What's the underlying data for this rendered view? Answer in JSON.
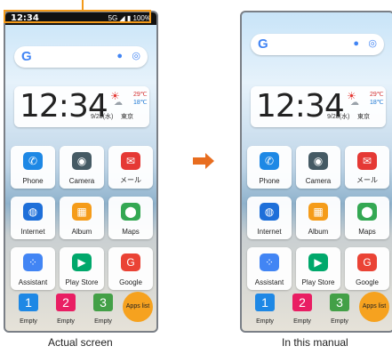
{
  "status": {
    "time": "12:34",
    "signal": "5G",
    "battery": "100%"
  },
  "clock": {
    "time": "12:34",
    "date": "9/28(水)",
    "city": "東京",
    "high": "29℃",
    "low": "18℃"
  },
  "apps": [
    {
      "label": "Phone",
      "icon": "phone-icon",
      "color": "#1e88e5",
      "glyph": "✆"
    },
    {
      "label": "Camera",
      "icon": "camera-icon",
      "color": "#455a64",
      "glyph": "◉"
    },
    {
      "label": "メール",
      "icon": "mail-icon",
      "color": "#e53935",
      "glyph": "✉"
    },
    {
      "label": "Internet",
      "icon": "globe-icon",
      "color": "#1e6fd9",
      "glyph": "◍"
    },
    {
      "label": "Album",
      "icon": "album-icon",
      "color": "#f59c1a",
      "glyph": "▦"
    },
    {
      "label": "Maps",
      "icon": "maps-icon",
      "color": "#34a853",
      "glyph": "⬤"
    },
    {
      "label": "Assistant",
      "icon": "assistant-icon",
      "color": "#4285f4",
      "glyph": "⁘"
    },
    {
      "label": "Play Store",
      "icon": "play-store-icon",
      "color": "#00a86b",
      "glyph": "▶"
    },
    {
      "label": "Google",
      "icon": "google-folder-icon",
      "color": "#ea4335",
      "glyph": "G"
    }
  ],
  "dock": [
    {
      "num": "1",
      "label": "Empty",
      "color": "#1e88e5"
    },
    {
      "num": "2",
      "label": "Empty",
      "color": "#e91e63"
    },
    {
      "num": "3",
      "label": "Empty",
      "color": "#43a047"
    }
  ],
  "apps_list_label": "Apps list",
  "captions": {
    "left": "Actual screen",
    "right": "In this manual"
  }
}
